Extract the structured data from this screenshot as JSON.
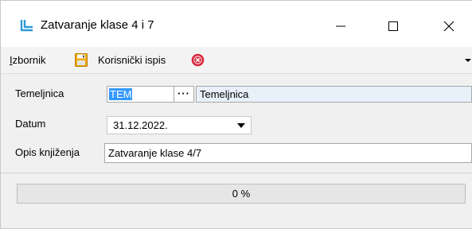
{
  "window": {
    "title": "Zatvaranje klase 4 i 7"
  },
  "menu": {
    "izbornik_first": "I",
    "izbornik_rest": "zbornik",
    "ispis_label": "Korisnički ispis"
  },
  "form": {
    "temeljnica_label": "Temeljnica",
    "temeljnica_code": "TEM",
    "lookup_label": "···",
    "temeljnica_name": "Temeljnica",
    "datum_label": "Datum",
    "datum_value": "31.12.2022.",
    "opis_label": "Opis knjiženja",
    "opis_value": "Zatvaranje klase 4/7"
  },
  "progress": {
    "value": 0,
    "text": "0 %"
  },
  "colors": {
    "accent": "#3399ff",
    "save_icon": "#f2a900",
    "close_icon": "#d7263d",
    "app_icon": "#2e9bd6"
  },
  "icons": [
    "app-icon",
    "minimize-icon",
    "maximize-icon",
    "close-icon",
    "save-icon",
    "close-circle-icon",
    "chevron-down-icon"
  ]
}
